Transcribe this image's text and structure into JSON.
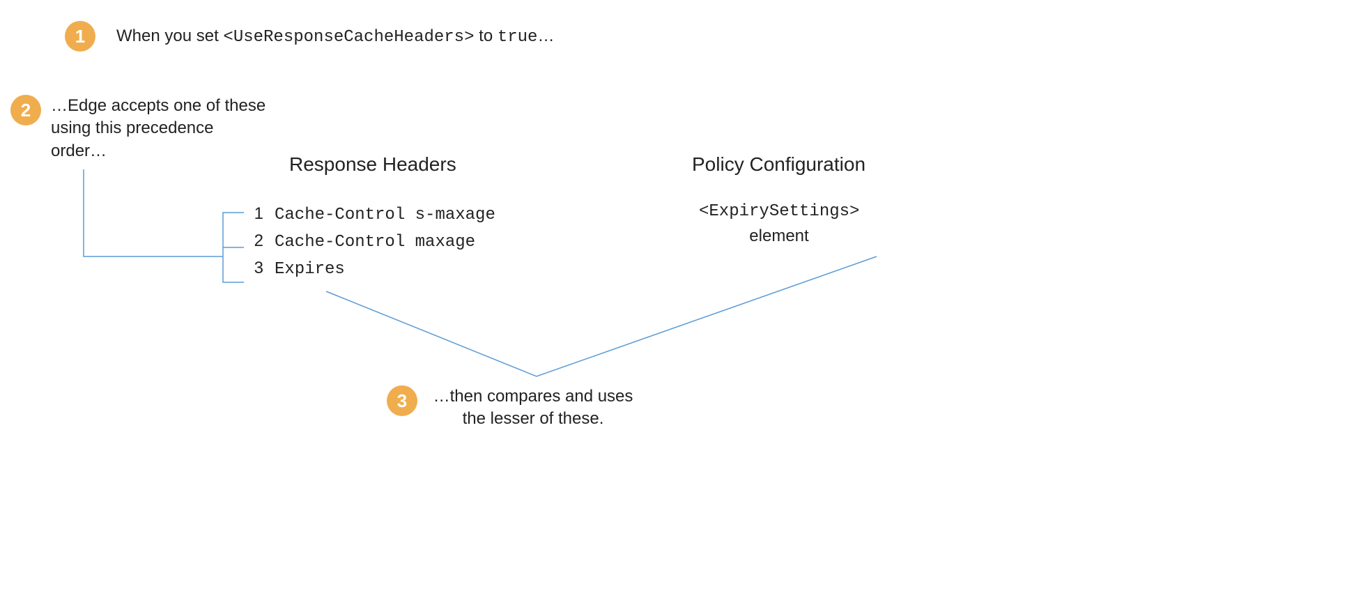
{
  "step1": {
    "badge": "1",
    "prefix": "When you set ",
    "code_tag": "<UseResponseCacheHeaders>",
    "mid": " to ",
    "code_val": "true",
    "suffix": "…"
  },
  "step2": {
    "badge": "2",
    "text": "…Edge accepts one of these using this precedence order…"
  },
  "headings": {
    "response": "Response Headers",
    "policy": "Policy Configuration"
  },
  "headers": [
    {
      "n": "1",
      "label": "Cache-Control s-maxage"
    },
    {
      "n": "2",
      "label": "Cache-Control maxage"
    },
    {
      "n": "3",
      "label": "Expires"
    }
  ],
  "policy": {
    "tag": "<ExpirySettings>",
    "word": "element"
  },
  "step3": {
    "badge": "3",
    "text": "…then compares and uses the lesser of these."
  },
  "colors": {
    "badge_bg": "#f0ad4e",
    "line": "#5B9BD5"
  }
}
